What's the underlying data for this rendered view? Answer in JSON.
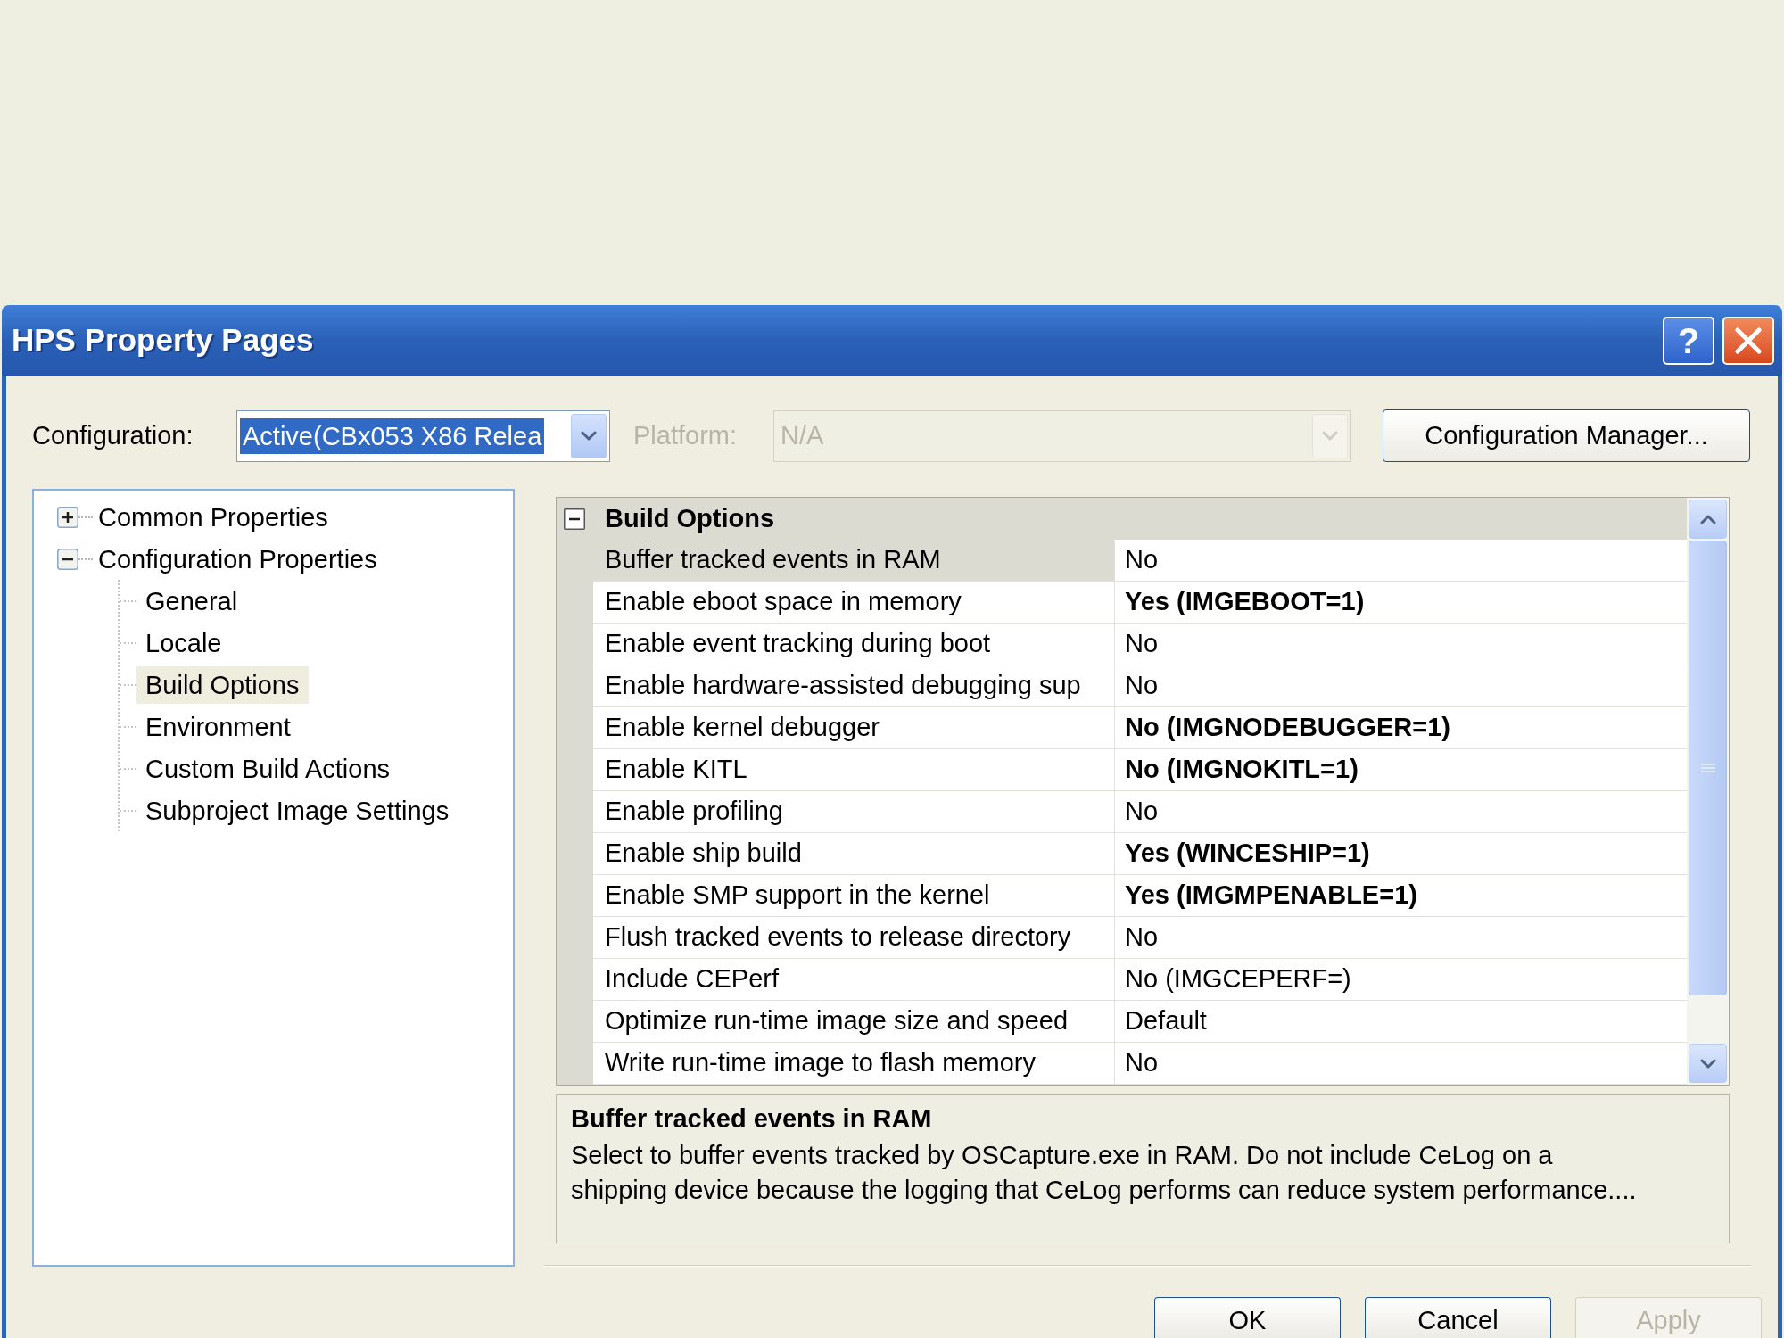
{
  "window": {
    "title": "HPS Property Pages",
    "help_label": "?"
  },
  "configuration": {
    "label": "Configuration:",
    "value": "Active(CBx053 X86 Relea",
    "focused": true
  },
  "platform": {
    "label": "Platform:",
    "value": "N/A",
    "disabled": true
  },
  "configuration_manager_button": {
    "label": "Configuration Manager..."
  },
  "tree": [
    {
      "label": "Common Properties",
      "expanded": false,
      "selected": false
    },
    {
      "label": "Configuration Properties",
      "expanded": true,
      "selected": false,
      "children": [
        {
          "label": "General",
          "selected": false
        },
        {
          "label": "Locale",
          "selected": false
        },
        {
          "label": "Build Options",
          "selected": true
        },
        {
          "label": "Environment",
          "selected": false
        },
        {
          "label": "Custom Build Actions",
          "selected": false
        },
        {
          "label": "Subproject Image Settings",
          "selected": false
        }
      ]
    }
  ],
  "property_grid": {
    "category": {
      "label": "Build Options",
      "expanded": true
    },
    "rows": [
      {
        "name": "Buffer tracked events in RAM",
        "value": "No",
        "modified": false,
        "selected": true
      },
      {
        "name": "Enable eboot space in memory",
        "value": "Yes (IMGEBOOT=1)",
        "modified": true,
        "selected": false
      },
      {
        "name": "Enable event tracking during boot",
        "value": "No",
        "modified": false,
        "selected": false
      },
      {
        "name": "Enable hardware-assisted debugging sup",
        "value": "No",
        "modified": false,
        "selected": false
      },
      {
        "name": "Enable kernel debugger",
        "value": "No (IMGNODEBUGGER=1)",
        "modified": true,
        "selected": false
      },
      {
        "name": "Enable KITL",
        "value": "No (IMGNOKITL=1)",
        "modified": true,
        "selected": false
      },
      {
        "name": "Enable profiling",
        "value": "No",
        "modified": false,
        "selected": false
      },
      {
        "name": "Enable ship build",
        "value": "Yes (WINCESHIP=1)",
        "modified": true,
        "selected": false
      },
      {
        "name": "Enable SMP support in the kernel",
        "value": "Yes (IMGMPENABLE=1)",
        "modified": true,
        "selected": false
      },
      {
        "name": "Flush tracked events to release directory",
        "value": "No",
        "modified": false,
        "selected": false
      },
      {
        "name": "Include CEPerf",
        "value": "No (IMGCEPERF=)",
        "modified": false,
        "selected": false
      },
      {
        "name": "Optimize run-time image size and speed",
        "value": "Default",
        "modified": false,
        "selected": false
      },
      {
        "name": "Write run-time image to flash memory",
        "value": "No",
        "modified": false,
        "selected": false
      }
    ]
  },
  "description": {
    "title": "Buffer tracked events in RAM",
    "text": "Select to buffer events tracked by OSCapture.exe in RAM. Do not include CeLog on a shipping device because the logging that CeLog performs can reduce system performance...."
  },
  "buttons": [
    {
      "label": "OK",
      "disabled": false
    },
    {
      "label": "Cancel",
      "disabled": false
    },
    {
      "label": "Apply",
      "disabled": true
    }
  ]
}
